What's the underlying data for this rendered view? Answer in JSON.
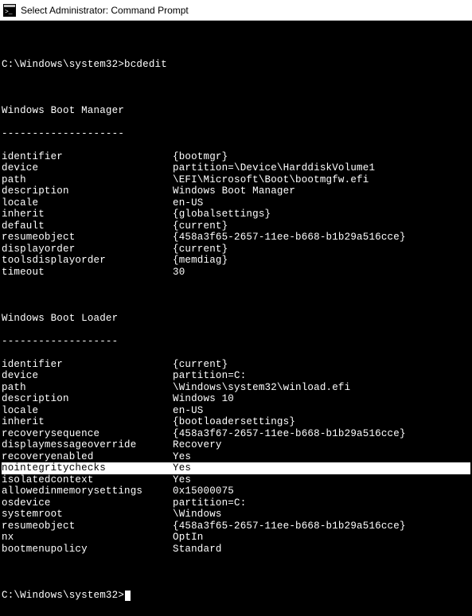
{
  "window": {
    "title": "Select Administrator: Command Prompt"
  },
  "terminal": {
    "prompt1": "C:\\Windows\\system32>bcdedit",
    "prompt2": "C:\\Windows\\system32>",
    "section1": {
      "title": "Windows Boot Manager",
      "dashes": "--------------------",
      "rows": [
        {
          "k": "identifier",
          "v": "{bootmgr}"
        },
        {
          "k": "device",
          "v": "partition=\\Device\\HarddiskVolume1"
        },
        {
          "k": "path",
          "v": "\\EFI\\Microsoft\\Boot\\bootmgfw.efi"
        },
        {
          "k": "description",
          "v": "Windows Boot Manager"
        },
        {
          "k": "locale",
          "v": "en-US"
        },
        {
          "k": "inherit",
          "v": "{globalsettings}"
        },
        {
          "k": "default",
          "v": "{current}"
        },
        {
          "k": "resumeobject",
          "v": "{458a3f65-2657-11ee-b668-b1b29a516cce}"
        },
        {
          "k": "displayorder",
          "v": "{current}"
        },
        {
          "k": "toolsdisplayorder",
          "v": "{memdiag}"
        },
        {
          "k": "timeout",
          "v": "30"
        }
      ]
    },
    "section2": {
      "title": "Windows Boot Loader",
      "dashes": "-------------------",
      "rows": [
        {
          "k": "identifier",
          "v": "{current}"
        },
        {
          "k": "device",
          "v": "partition=C:"
        },
        {
          "k": "path",
          "v": "\\Windows\\system32\\winload.efi"
        },
        {
          "k": "description",
          "v": "Windows 10"
        },
        {
          "k": "locale",
          "v": "en-US"
        },
        {
          "k": "inherit",
          "v": "{bootloadersettings}"
        },
        {
          "k": "recoverysequence",
          "v": "{458a3f67-2657-11ee-b668-b1b29a516cce}"
        },
        {
          "k": "displaymessageoverride",
          "v": "Recovery"
        },
        {
          "k": "recoveryenabled",
          "v": "Yes"
        },
        {
          "k": "nointegritychecks",
          "v": "Yes",
          "highlight": true
        },
        {
          "k": "isolatedcontext",
          "v": "Yes"
        },
        {
          "k": "allowedinmemorysettings",
          "v": "0x15000075"
        },
        {
          "k": "osdevice",
          "v": "partition=C:"
        },
        {
          "k": "systemroot",
          "v": "\\Windows"
        },
        {
          "k": "resumeobject",
          "v": "{458a3f65-2657-11ee-b668-b1b29a516cce}"
        },
        {
          "k": "nx",
          "v": "OptIn"
        },
        {
          "k": "bootmenupolicy",
          "v": "Standard"
        }
      ]
    }
  }
}
